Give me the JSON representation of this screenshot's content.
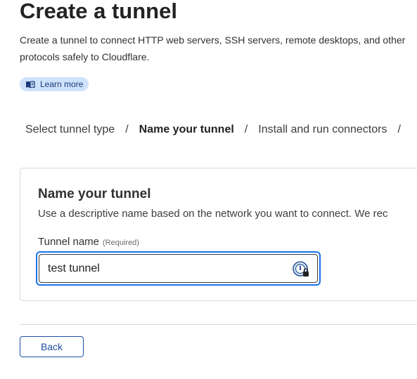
{
  "header": {
    "title": "Create a tunnel",
    "description": "Create a tunnel to connect HTTP web servers, SSH servers, remote desktops, and other protocols safely to Cloudflare.",
    "learn_more_label": "Learn more",
    "learn_more_icon": "book-icon"
  },
  "steps": [
    {
      "label": "Select tunnel type",
      "current": false
    },
    {
      "label": "Name your tunnel",
      "current": true
    },
    {
      "label": "Install and run connectors",
      "current": false
    }
  ],
  "step_separator": "/",
  "form": {
    "title": "Name your tunnel",
    "description": "Use a descriptive name based on the network you want to connect. We rec",
    "field_label": "Tunnel name",
    "field_required": "(Required)",
    "field_value": "test tunnel",
    "field_icon": "password-manager-icon"
  },
  "footer": {
    "back_label": "Back"
  },
  "colors": {
    "accent": "#1a73e8",
    "button_border": "#1f4fa5",
    "learn_more_bg": "#cfe2fb"
  }
}
